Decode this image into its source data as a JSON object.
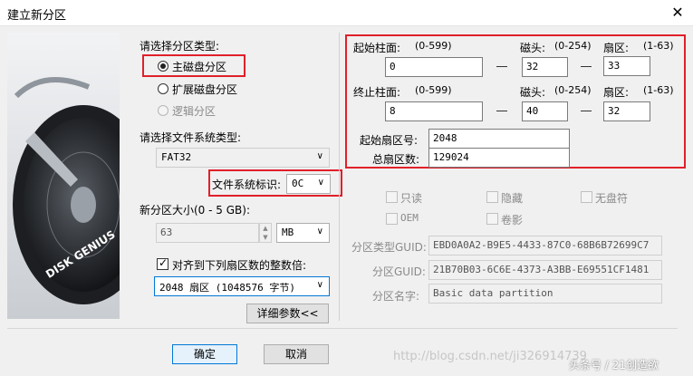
{
  "window": {
    "title": "建立新分区"
  },
  "partition_type": {
    "label": "请选择分区类型:",
    "options": [
      "主磁盘分区",
      "扩展磁盘分区",
      "逻辑分区"
    ],
    "selected": "主磁盘分区"
  },
  "filesystem": {
    "label": "请选择文件系统类型:",
    "value": "FAT32",
    "id_label": "文件系统标识:",
    "id_value": "0C"
  },
  "size": {
    "label": "新分区大小(0 - 5 GB):",
    "value": "63",
    "unit": "MB"
  },
  "align": {
    "label": "对齐到下列扇区数的整数倍:",
    "checked": true,
    "value": "2048 扇区 (1048576 字节)"
  },
  "advanced_button": "详细参数<<",
  "geometry": {
    "start_cyl_label": "起始柱面:",
    "start_cyl_range": "(0-599)",
    "start_cyl": "0",
    "start_head_label": "磁头:",
    "start_head_range": "(0-254)",
    "start_head": "32",
    "start_sector_label": "扇区:",
    "start_sector_range": "(1-63)",
    "start_sector": "33",
    "end_cyl_label": "终止柱面:",
    "end_cyl_range": "(0-599)",
    "end_cyl": "8",
    "end_head_label": "磁头:",
    "end_head_range": "(0-254)",
    "end_head": "40",
    "end_sector_label": "扇区:",
    "end_sector_range": "(1-63)",
    "end_sector": "32",
    "start_lba_label": "起始扇区号:",
    "start_lba": "2048",
    "total_sectors_label": "总扇区数:",
    "total_sectors": "129024"
  },
  "attributes": {
    "readonly": "只读",
    "hidden": "隐藏",
    "no_drive_letter": "无盘符",
    "oem": "OEM",
    "shadow": "卷影"
  },
  "guid": {
    "type_label": "分区类型GUID:",
    "type_value": "EBD0A0A2-B9E5-4433-87C0-68B6B72699C7",
    "part_label": "分区GUID:",
    "part_value": "21B70B03-6C6E-4373-A3BB-E69551CF1481",
    "name_label": "分区名字:",
    "name_value": "Basic data partition"
  },
  "buttons": {
    "ok": "确定",
    "cancel": "取消"
  },
  "banner_text": "DISK GENIUS",
  "watermark": {
    "url": "http://blog.csdn.net/ji326914739",
    "credit": "头条号 / 21创造欲"
  }
}
